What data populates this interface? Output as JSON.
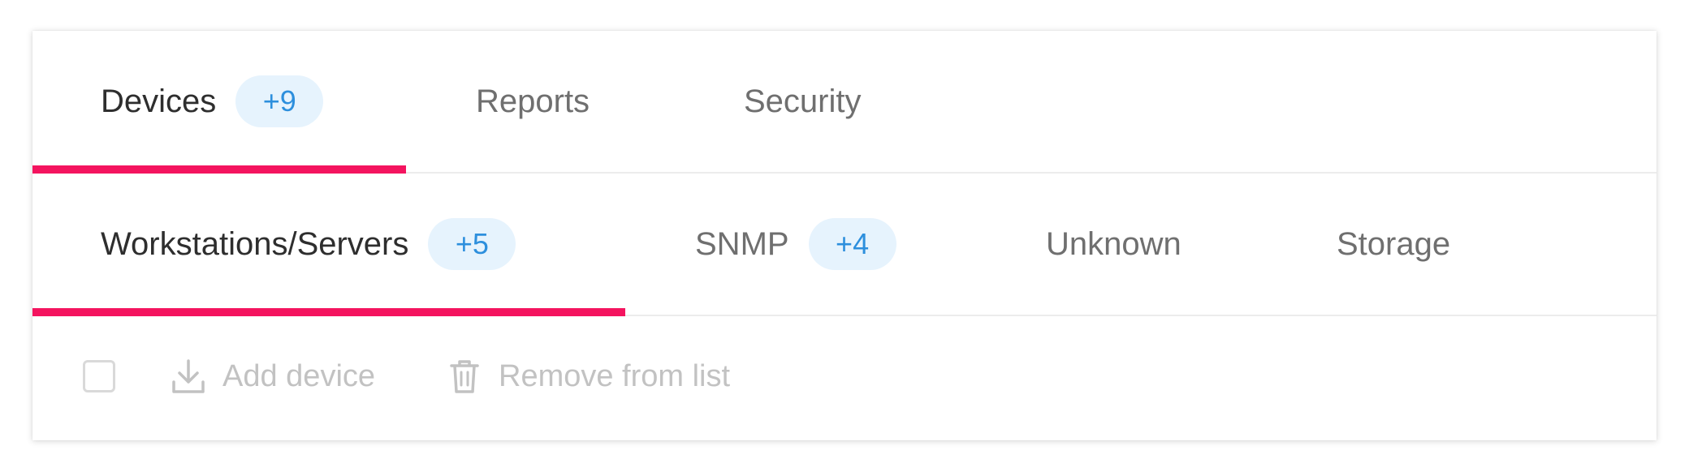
{
  "primary_tabs": [
    {
      "label": "Devices",
      "badge": "+9",
      "active": true
    },
    {
      "label": "Reports",
      "active": false
    },
    {
      "label": "Security",
      "active": false
    }
  ],
  "secondary_tabs": [
    {
      "label": "Workstations/Servers",
      "badge": "+5",
      "active": true
    },
    {
      "label": "SNMP",
      "badge": "+4",
      "active": false
    },
    {
      "label": "Unknown",
      "active": false
    },
    {
      "label": "Storage",
      "active": false
    }
  ],
  "toolbar": {
    "add_device_label": "Add device",
    "add_device_icon": "download-icon",
    "remove_label": "Remove from list",
    "remove_icon": "trash-icon",
    "select_all_checked": false
  },
  "colors": {
    "accent_underline": "#f4145f",
    "badge_background": "#e6f3fd",
    "badge_text": "#2d8fdd",
    "disabled_text": "#c2c2c2"
  }
}
